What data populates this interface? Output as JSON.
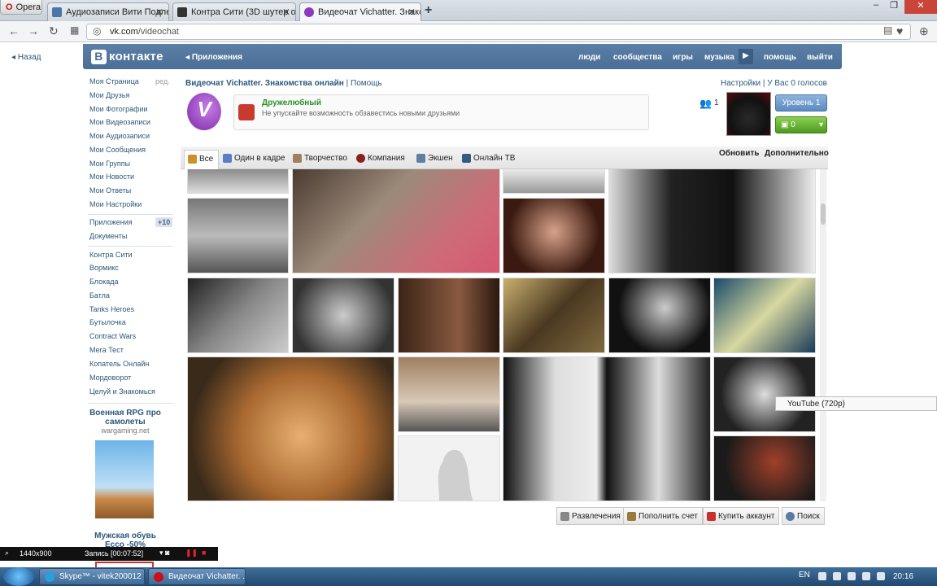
{
  "browser": {
    "menu_label": "Opera",
    "tabs": [
      {
        "title": "Аудиозаписи Вити Подле",
        "icon": "pause-icon"
      },
      {
        "title": "Контра Сити (3D шутер о",
        "icon": "game-icon"
      },
      {
        "title": "Видеочат Vichatter. Знако",
        "icon": "vichatter-icon"
      }
    ],
    "url_host": "vk.com",
    "url_path": "/videochat"
  },
  "vk": {
    "back": "Назад",
    "logo": "контакте",
    "logo_letter": "В",
    "apps_link": "Приложения",
    "topnav": [
      "люди",
      "сообщества",
      "игры",
      "музыка",
      "помощь",
      "выйти"
    ],
    "left_menu": [
      "Моя Страница",
      "Мои Друзья",
      "Мои Фотографии",
      "Мои Видеозаписи",
      "Мои Аудиозаписи",
      "Мои Сообщения",
      "Мои Группы",
      "Мои Новости",
      "Мои Ответы",
      "Мои Настройки"
    ],
    "edit_label": "ред.",
    "menu2": [
      "Приложения",
      "Документы"
    ],
    "apps_badge": "+10",
    "games": [
      "Контра Сити",
      "Вормикс",
      "Блокада",
      "Батла",
      "Tanks Heroes",
      "Бутылочка",
      "Contract Wars",
      "Мега Тест",
      "Копатель Онлайн",
      "Мордоворот",
      "Целуй и Знакомься"
    ],
    "ad1_title": "Военная RPG про самолеты",
    "ad1_sub": "wargaming.net",
    "ad2_title": "Мужская обувь Ecco -50%"
  },
  "app": {
    "title": "Видеочат Vichatter. Знакомства онлайн",
    "help": "Помощь",
    "settings": "Настройки",
    "votes": "У Вас 0 голосов",
    "logo_letter": "V",
    "promo_title": "Дружелюбный",
    "promo_sub": "Не упускайте возможность обзавестись новыми друзьями",
    "friends_count": "1",
    "level": "Уровень 1",
    "coins": "0",
    "tabs": [
      "Все",
      "Один в кадре",
      "Творчество",
      "Компания",
      "Экшен",
      "Онлайн ТВ"
    ],
    "refresh": "Обновить",
    "more": "Дополнительно",
    "bottom": [
      "Развлечения",
      "Пополнить счет",
      "Купить аккаунт",
      "Поиск"
    ],
    "tooltip": "YouTube (720p)"
  },
  "recorder": {
    "resolution": "1440x900",
    "status": "Запись [00:07:52]"
  },
  "taskbar": {
    "tasks": [
      "Skype™ - vitek200012",
      "Видеочат Vichatter. ..."
    ],
    "lang": "EN",
    "clock": "20:16"
  },
  "colors": {
    "vk_blue": "#4a6e96",
    "link": "#2b587a",
    "promo_green": "#2a8f2a"
  }
}
